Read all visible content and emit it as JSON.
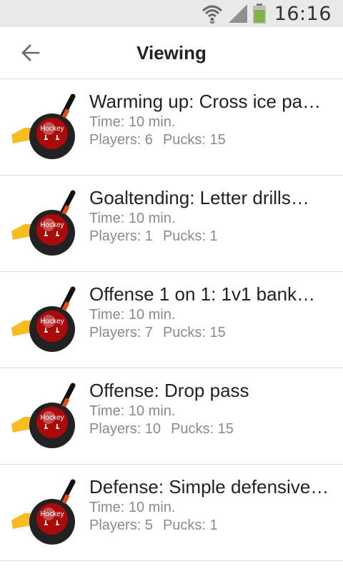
{
  "status_bar": {
    "time": "16:16",
    "icons": [
      "wifi-icon",
      "signal-icon",
      "battery-icon"
    ]
  },
  "app_bar": {
    "title": "Viewing",
    "back_icon": "arrow-left-icon"
  },
  "drills": [
    {
      "title": "Warming up: Cross ice pa…",
      "time": "Time: 10 min.",
      "players": "Players: 6",
      "pucks": "Pucks: 15",
      "icon": "hockey-puck-icon",
      "icon_label": "Hockey"
    },
    {
      "title": "Goaltending: Letter drills…",
      "time": "Time: 10 min.",
      "players": "Players: 1",
      "pucks": "Pucks: 1",
      "icon": "hockey-puck-icon",
      "icon_label": "Hockey"
    },
    {
      "title": "Offense 1 on 1: 1v1 bank…",
      "time": "Time: 10 min.",
      "players": "Players: 7",
      "pucks": "Pucks: 15",
      "icon": "hockey-puck-icon",
      "icon_label": "Hockey"
    },
    {
      "title": "Offense: Drop pass",
      "time": "Time: 10 min.",
      "players": "Players: 10",
      "pucks": "Pucks: 15",
      "icon": "hockey-puck-icon",
      "icon_label": "Hockey"
    },
    {
      "title": "Defense: Simple defensive…",
      "time": "Time: 10 min.",
      "players": "Players: 5",
      "pucks": "Pucks: 1",
      "icon": "hockey-puck-icon",
      "icon_label": "Hockey"
    }
  ]
}
